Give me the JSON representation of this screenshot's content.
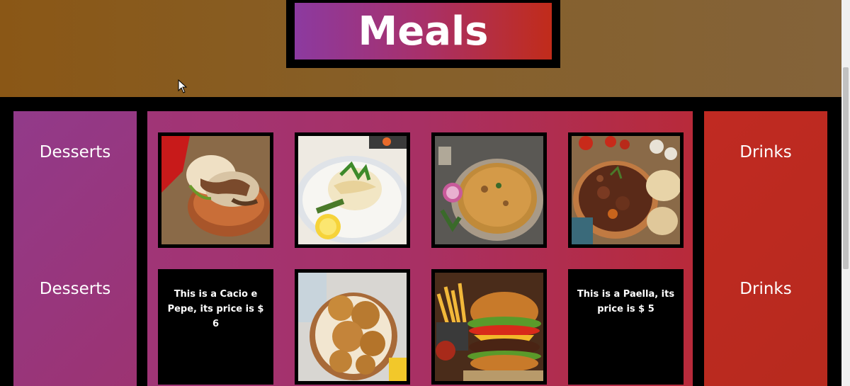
{
  "header": {
    "title": "Meals"
  },
  "sidebar_left": {
    "items": [
      {
        "label": "Desserts"
      },
      {
        "label": "Desserts"
      }
    ]
  },
  "sidebar_right": {
    "items": [
      {
        "label": "Drinks"
      },
      {
        "label": "Drinks"
      }
    ]
  },
  "menu": {
    "tiles": [
      {
        "type": "image",
        "icon": "arepa-food-photo"
      },
      {
        "type": "image",
        "icon": "fish-fillet-food-photo"
      },
      {
        "type": "image",
        "icon": "biryani-rice-food-photo"
      },
      {
        "type": "image",
        "icon": "stew-food-photo"
      },
      {
        "type": "text",
        "text": "This is a Cacio e Pepe, its price is $ 6"
      },
      {
        "type": "image",
        "icon": "fried-chicken-food-photo"
      },
      {
        "type": "image",
        "icon": "burger-fries-food-photo"
      },
      {
        "type": "text",
        "text": "This is a Paella, its price is $ 5"
      }
    ]
  },
  "colors": {
    "header_bg": "#8a5716",
    "left_panel": "#923a8a",
    "center_panel": "#a83064",
    "right_panel": "#c02a22",
    "tile_border": "#000000",
    "text": "#ffffff"
  }
}
